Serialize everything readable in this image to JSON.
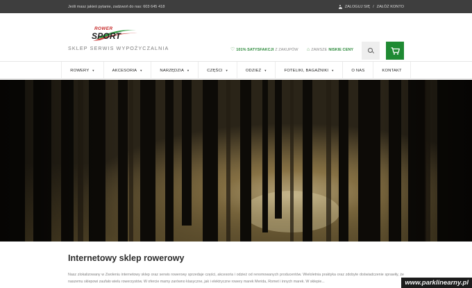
{
  "topbar": {
    "contact_text": "Jeśli masz jakieś pytanie, zadzwoń do nas: 603 645 418",
    "account_icon": "person-icon",
    "login_link": "ZALOGUJ SIĘ",
    "separator": "/",
    "register_link": "ZAŁÓŻ KONTO"
  },
  "logo": {
    "line1": "ROWER",
    "line2": "SPORT",
    "tagline": "SKLEP  SERWIS  WYPOŻYCZALNIA"
  },
  "usp": {
    "one_strong": "101% SATYSFAKCJI",
    "one_rest": " Z ZAKUPÓW",
    "two_rest": "ZAWSZE ",
    "two_strong": "NISKIE CENY"
  },
  "header_icons": {
    "search": "search-icon",
    "cart": "cart-icon",
    "cart_color": "#1f8a33"
  },
  "nav": {
    "items": [
      {
        "label": "ROWERY",
        "caret": "▼"
      },
      {
        "label": "AKCESORIA",
        "caret": "▼"
      },
      {
        "label": "NARZĘDZIA",
        "caret": "▼"
      },
      {
        "label": "CZĘŚCI",
        "caret": "▼"
      },
      {
        "label": "ODZIEŻ",
        "caret": "▼"
      },
      {
        "label": "FOTELIKI, BAGAŻNIKI",
        "caret": "▼"
      },
      {
        "label": "O NAS",
        "caret": ""
      },
      {
        "label": "KONTAKT",
        "caret": ""
      }
    ]
  },
  "content": {
    "heading": "Internetowy sklep rowerowy",
    "paragraph": "Nasz zlokalizowany w Zwoleniu internetowy sklep oraz serwis rowerowy sprzedaje części, akcesoria i odzież od renomowanych producentów. Wieloletnia praktyka oraz zdobyte doświadczenie sprawiły, że naszemu sklepowi zaufało wielu rowerzystów. W ofercie mamy zarówno klasyczne, jak i elektryczne rowery marek Merida, Romet i innych marek. W sklepie..."
  },
  "watermark": "www.parklinearny.pl",
  "colors": {
    "topbar_bg": "#3e3e3e",
    "accent_green": "#1f8a33",
    "logo_red": "#c62828"
  }
}
